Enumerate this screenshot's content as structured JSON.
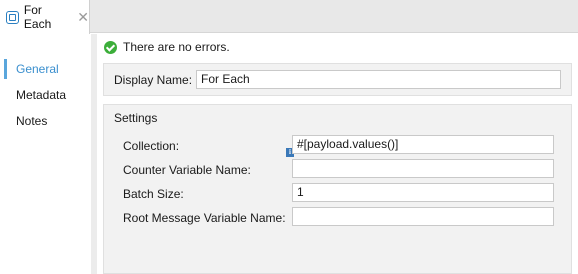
{
  "tab": {
    "label": "For Each"
  },
  "sidenav": {
    "items": [
      {
        "label": "General",
        "active": true
      },
      {
        "label": "Metadata",
        "active": false
      },
      {
        "label": "Notes",
        "active": false
      }
    ]
  },
  "status": {
    "text": "There are no errors."
  },
  "display": {
    "label": "Display Name:",
    "value": "For Each"
  },
  "settings": {
    "title": "Settings",
    "collection": {
      "label": "Collection:",
      "value": "#[payload.values()]"
    },
    "counter": {
      "label": "Counter Variable Name:",
      "value": ""
    },
    "batch": {
      "label": "Batch Size:",
      "value": "1"
    },
    "root": {
      "label": "Root Message Variable Name:",
      "value": ""
    }
  },
  "colors": {
    "accent": "#3a8fce",
    "ok": "#3cae3a"
  }
}
